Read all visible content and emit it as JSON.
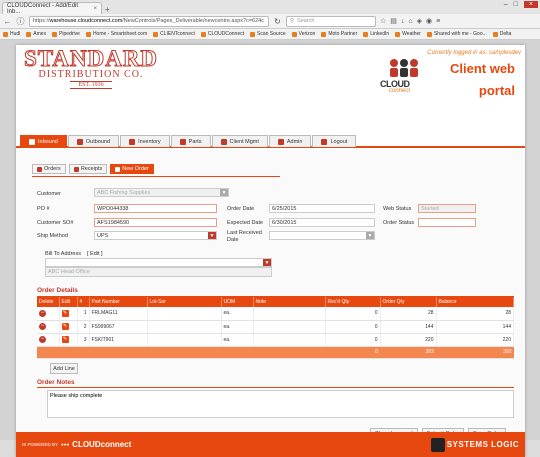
{
  "browser": {
    "tab_title": "CLOUDConnect - Add/Edit Inb...",
    "url_domain": "warehouse.cloudconnect.com",
    "url_prefix": "https://",
    "url_path": "/NewControls/Pages_Deliverable/newcentre.aspx?c=624c",
    "search_placeholder": "Search",
    "bookmarks": [
      "Hudl",
      "Amex",
      "Pipedrive",
      "Home - Smartsheet.com",
      "CLIENTconnect",
      "CLOUDConnect",
      "Scan Source",
      "Verizon",
      "Moto Partner",
      "LinkedIn",
      "Weather",
      "Shared with me - Goo...",
      "Delta"
    ]
  },
  "header": {
    "logo_line1": "STANDARD",
    "logo_line2": "DISTRIBUTION CO.",
    "logo_est": "EST. 1936",
    "login_text": "Currently logged in as: samplesdev",
    "cc_text": "CLOUD",
    "cc_sub": "connect",
    "portal_line1": "Client web",
    "portal_line2": "portal"
  },
  "nav": {
    "tabs": [
      {
        "label": "Inbound",
        "active": true
      },
      {
        "label": "Outbound",
        "active": false
      },
      {
        "label": "Inventory",
        "active": false
      },
      {
        "label": "Parts",
        "active": false
      },
      {
        "label": "Client Mgmt",
        "active": false
      },
      {
        "label": "Admin",
        "active": false
      },
      {
        "label": "Logout",
        "active": false
      }
    ]
  },
  "subtabs": [
    {
      "label": "Orders",
      "active": false
    },
    {
      "label": "Receipts",
      "active": false
    },
    {
      "label": "New Order",
      "active": true
    }
  ],
  "form": {
    "customer_label": "Customer",
    "customer_value": "ABC Fishing Supplies",
    "po_label": "PO #",
    "po_value": "WPO044338",
    "cust_so_label": "Customer SO#",
    "cust_so_value": "AFS1984590",
    "ship_method_label": "Ship Method",
    "ship_method_value": "UPS",
    "order_date_label": "Order Date",
    "order_date_value": "6/25/2015",
    "expected_date_label": "Expected Date",
    "expected_date_value": "6/30/2015",
    "last_received_label1": "Last Received",
    "last_received_label2": "Date",
    "web_status_label": "Web Status",
    "web_status_value": "Started",
    "order_status_label": "Order Status",
    "bill_to_label": "Bill To Address",
    "bill_to_edit": "[ Edit ]",
    "bill_to_address": "ABC Head Office"
  },
  "order_details": {
    "title": "Order Details",
    "columns": [
      "Delete",
      "Edit",
      "#",
      "Part Number",
      "Lot-Ser",
      "UOM",
      "Note",
      "Rec'd Qty",
      "Order Qty",
      "Balance"
    ],
    "rows": [
      {
        "num": "1",
        "part": "FRLMAG11",
        "lot": "",
        "uom": "ea.",
        "note": "",
        "recd": "0",
        "order": "28",
        "balance": "28"
      },
      {
        "num": "2",
        "part": "FS999067",
        "lot": "",
        "uom": "ea.",
        "note": "",
        "recd": "0",
        "order": "144",
        "balance": "144"
      },
      {
        "num": "3",
        "part": "FSKIT901",
        "lot": "",
        "uom": "ea.",
        "note": "",
        "recd": "0",
        "order": "220",
        "balance": "220"
      }
    ],
    "total_recd": "0",
    "total_order": "392",
    "total_balance": "392",
    "add_line": "Add Line"
  },
  "notes": {
    "title": "Order Notes",
    "value": "Please ship complete"
  },
  "buttons": {
    "close": "Close (no save)",
    "submit": "Submit Order",
    "save": "Save Order"
  },
  "footer": {
    "powered_by": "IS POWERED BY",
    "cc_brand": "CLOUDconnect",
    "systems_logic": "SYSTEMS LOGIC"
  }
}
